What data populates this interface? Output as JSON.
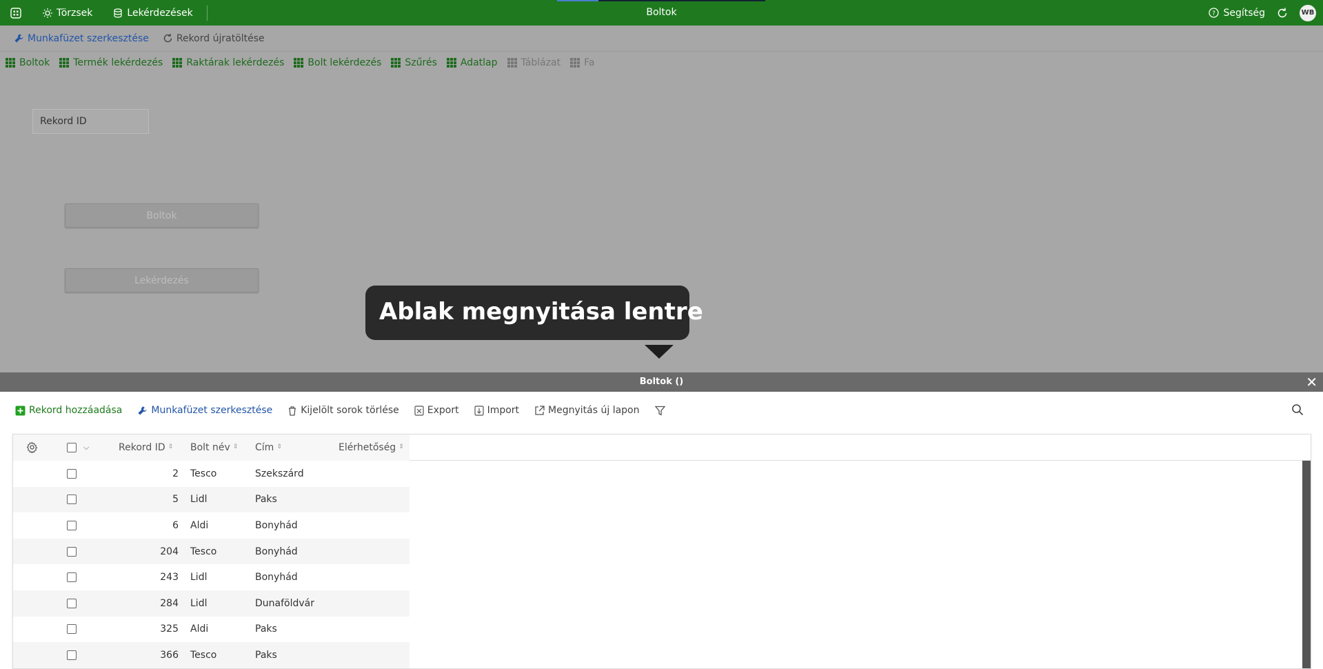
{
  "topbar": {
    "title": "Boltok",
    "nav": [
      {
        "label": "Törzsek"
      },
      {
        "label": "Lekérdezések"
      }
    ],
    "help_label": "Segítség",
    "avatar_initials": "WB"
  },
  "toolbar": {
    "edit_workbook_label": "Munkafüzet szerkesztése",
    "reload_record_label": "Rekord újratöltése"
  },
  "tabs": [
    {
      "label": "Boltok",
      "disabled": false
    },
    {
      "label": "Termék lekérdezés",
      "disabled": false
    },
    {
      "label": "Raktárak lekérdezés",
      "disabled": false
    },
    {
      "label": "Bolt lekérdezés",
      "disabled": false
    },
    {
      "label": "Szűrés",
      "disabled": false
    },
    {
      "label": "Adatlap",
      "disabled": false
    },
    {
      "label": "Táblázat",
      "disabled": true
    },
    {
      "label": "Fa",
      "disabled": true
    }
  ],
  "form": {
    "record_id_label": "Rekord ID",
    "boltok_button_label": "Boltok",
    "query_button_label": "Lekérdezés"
  },
  "tooltip": {
    "text": "Ablak megnyitása lentre"
  },
  "panel": {
    "title": "Boltok ()",
    "toolbar": {
      "add_record": "Rekord hozzáadása",
      "edit_workbook": "Munkafüzet szerkesztése",
      "delete_selected": "Kijelölt sorok törlése",
      "export": "Export",
      "import": "Import",
      "open_new_tab": "Megnyitás új lapon"
    },
    "table": {
      "columns": [
        "Rekord ID",
        "Bolt név",
        "Cím",
        "Elérhetőség"
      ],
      "rows": [
        {
          "id": "2",
          "name": "Tesco",
          "address": "Szekszárd",
          "contact": ""
        },
        {
          "id": "5",
          "name": "Lidl",
          "address": "Paks",
          "contact": ""
        },
        {
          "id": "6",
          "name": "Aldi",
          "address": "Bonyhád",
          "contact": ""
        },
        {
          "id": "204",
          "name": "Tesco",
          "address": "Bonyhád",
          "contact": ""
        },
        {
          "id": "243",
          "name": "Lidl",
          "address": "Bonyhád",
          "contact": ""
        },
        {
          "id": "284",
          "name": "Lidl",
          "address": "Dunaföldvár",
          "contact": ""
        },
        {
          "id": "325",
          "name": "Aldi",
          "address": "Paks",
          "contact": ""
        },
        {
          "id": "366",
          "name": "Tesco",
          "address": "Paks",
          "contact": ""
        }
      ]
    }
  },
  "colors": {
    "topbar_bg": "#1f7a1f",
    "tab_green": "#1d6b1d",
    "link_blue": "#2255a8",
    "overlay_gray": "#a7a7a7"
  }
}
